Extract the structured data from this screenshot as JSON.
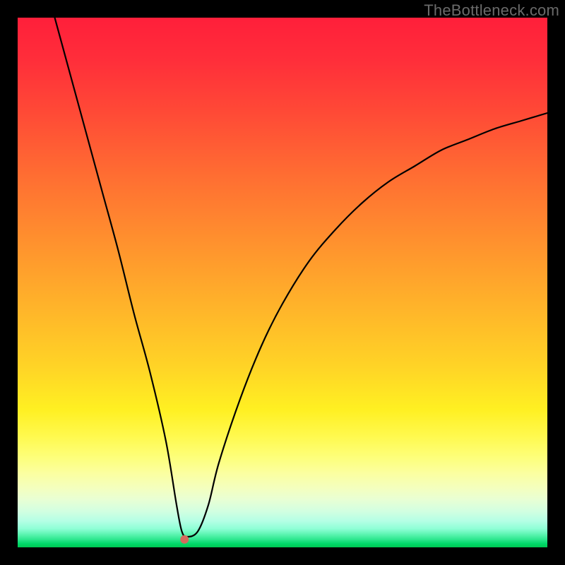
{
  "watermark": "TheBottleneck.com",
  "marker_color": "#d46a5c",
  "curve_color": "#000000",
  "chart_data": {
    "type": "line",
    "title": "",
    "xlabel": "",
    "ylabel": "",
    "xlim": [
      0,
      100
    ],
    "ylim": [
      0,
      100
    ],
    "grid": false,
    "series": [
      {
        "name": "bottleneck-curve",
        "x": [
          7,
          10,
          13,
          16,
          19,
          22,
          25,
          28,
          30,
          31,
          32,
          34,
          36,
          38,
          42,
          46,
          50,
          55,
          60,
          65,
          70,
          75,
          80,
          85,
          90,
          95,
          100
        ],
        "y": [
          100,
          89,
          78,
          67,
          56,
          44,
          33,
          20,
          8,
          3,
          2,
          3,
          8,
          16,
          28,
          38,
          46,
          54,
          60,
          65,
          69,
          72,
          75,
          77,
          79,
          80.5,
          82
        ]
      }
    ],
    "annotations": [
      {
        "name": "optimal-point",
        "x": 31.5,
        "y": 1.5
      }
    ],
    "background_gradient": {
      "orientation": "vertical",
      "stops": [
        {
          "pos": 0.0,
          "color": "#ff1f3a"
        },
        {
          "pos": 0.5,
          "color": "#ffb22a"
        },
        {
          "pos": 0.78,
          "color": "#fff94e"
        },
        {
          "pos": 1.0,
          "color": "#00c853"
        }
      ]
    }
  }
}
